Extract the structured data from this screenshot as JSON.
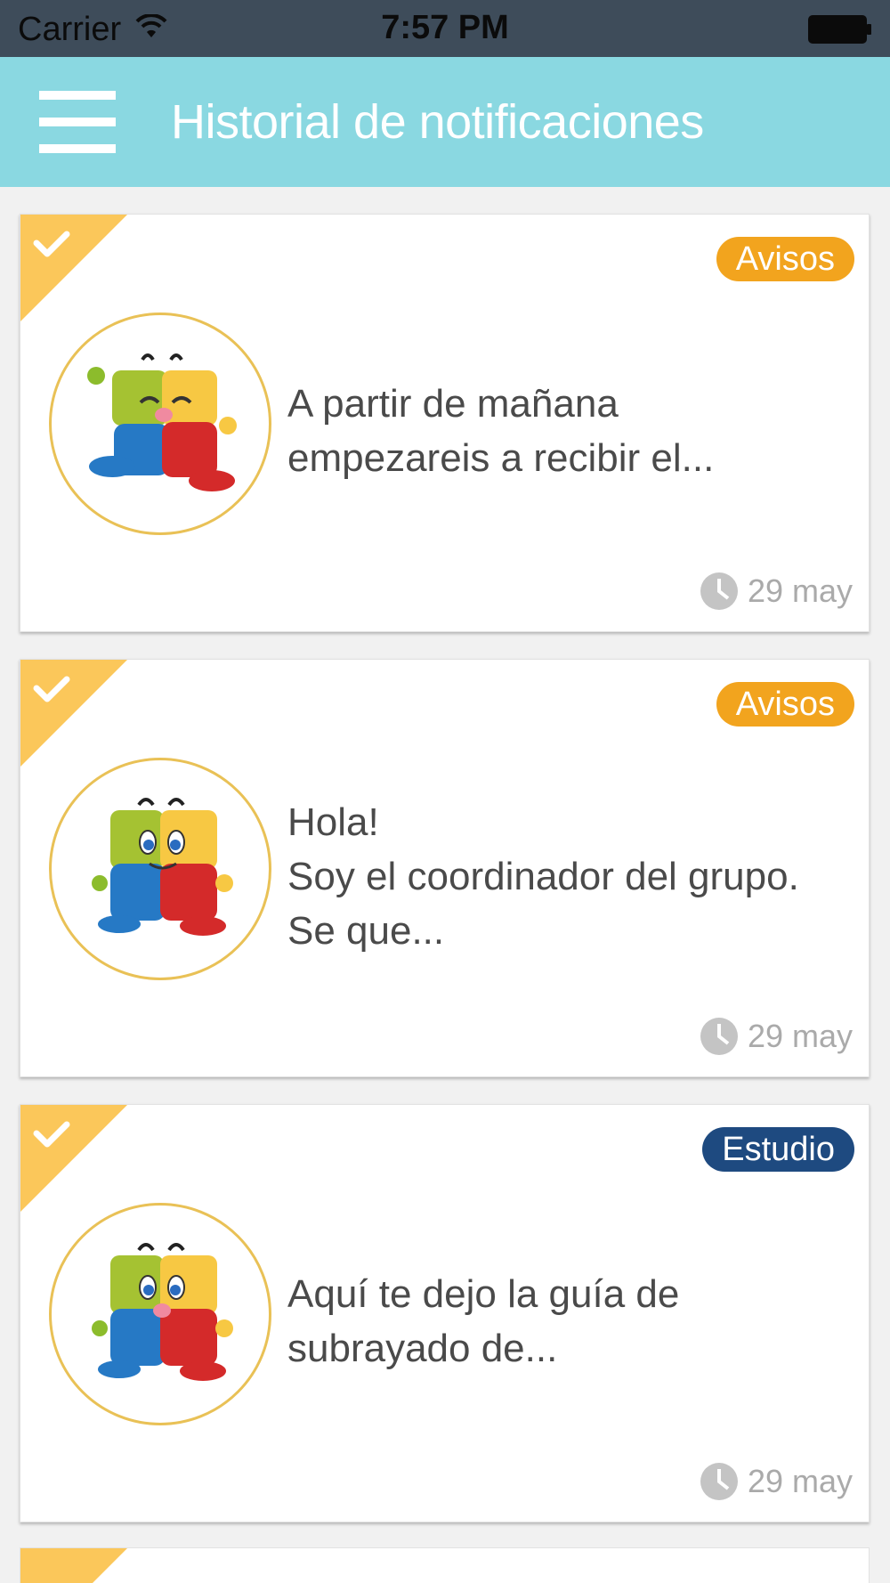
{
  "status_bar": {
    "carrier": "Carrier",
    "time": "7:57 PM"
  },
  "header": {
    "title": "Historial de notificaciones",
    "menu_icon": "hamburger-menu-icon"
  },
  "colors": {
    "nav_bar": "#8ad8e1",
    "badge_avisos": "#f2a41e",
    "badge_estudio": "#1e4a80",
    "read_corner": "#fbc75a",
    "avatar_ring": "#e9c156"
  },
  "notifications": [
    {
      "category": "Avisos",
      "message": "A partir de mañana\nempezareis a recibir el...",
      "date": "29 may",
      "read": true,
      "avatar": "mascot-blocks-eyes-closed-icon"
    },
    {
      "category": "Avisos",
      "message": "Hola!\nSoy el coordinador del grupo.\nSe que...",
      "date": "29 may",
      "read": true,
      "avatar": "mascot-blocks-eyes-open-icon"
    },
    {
      "category": "Estudio",
      "message": "Aquí te dejo la guía de\nsubrayado de...",
      "date": "29 may",
      "read": true,
      "avatar": "mascot-blocks-eyes-open-icon"
    }
  ]
}
